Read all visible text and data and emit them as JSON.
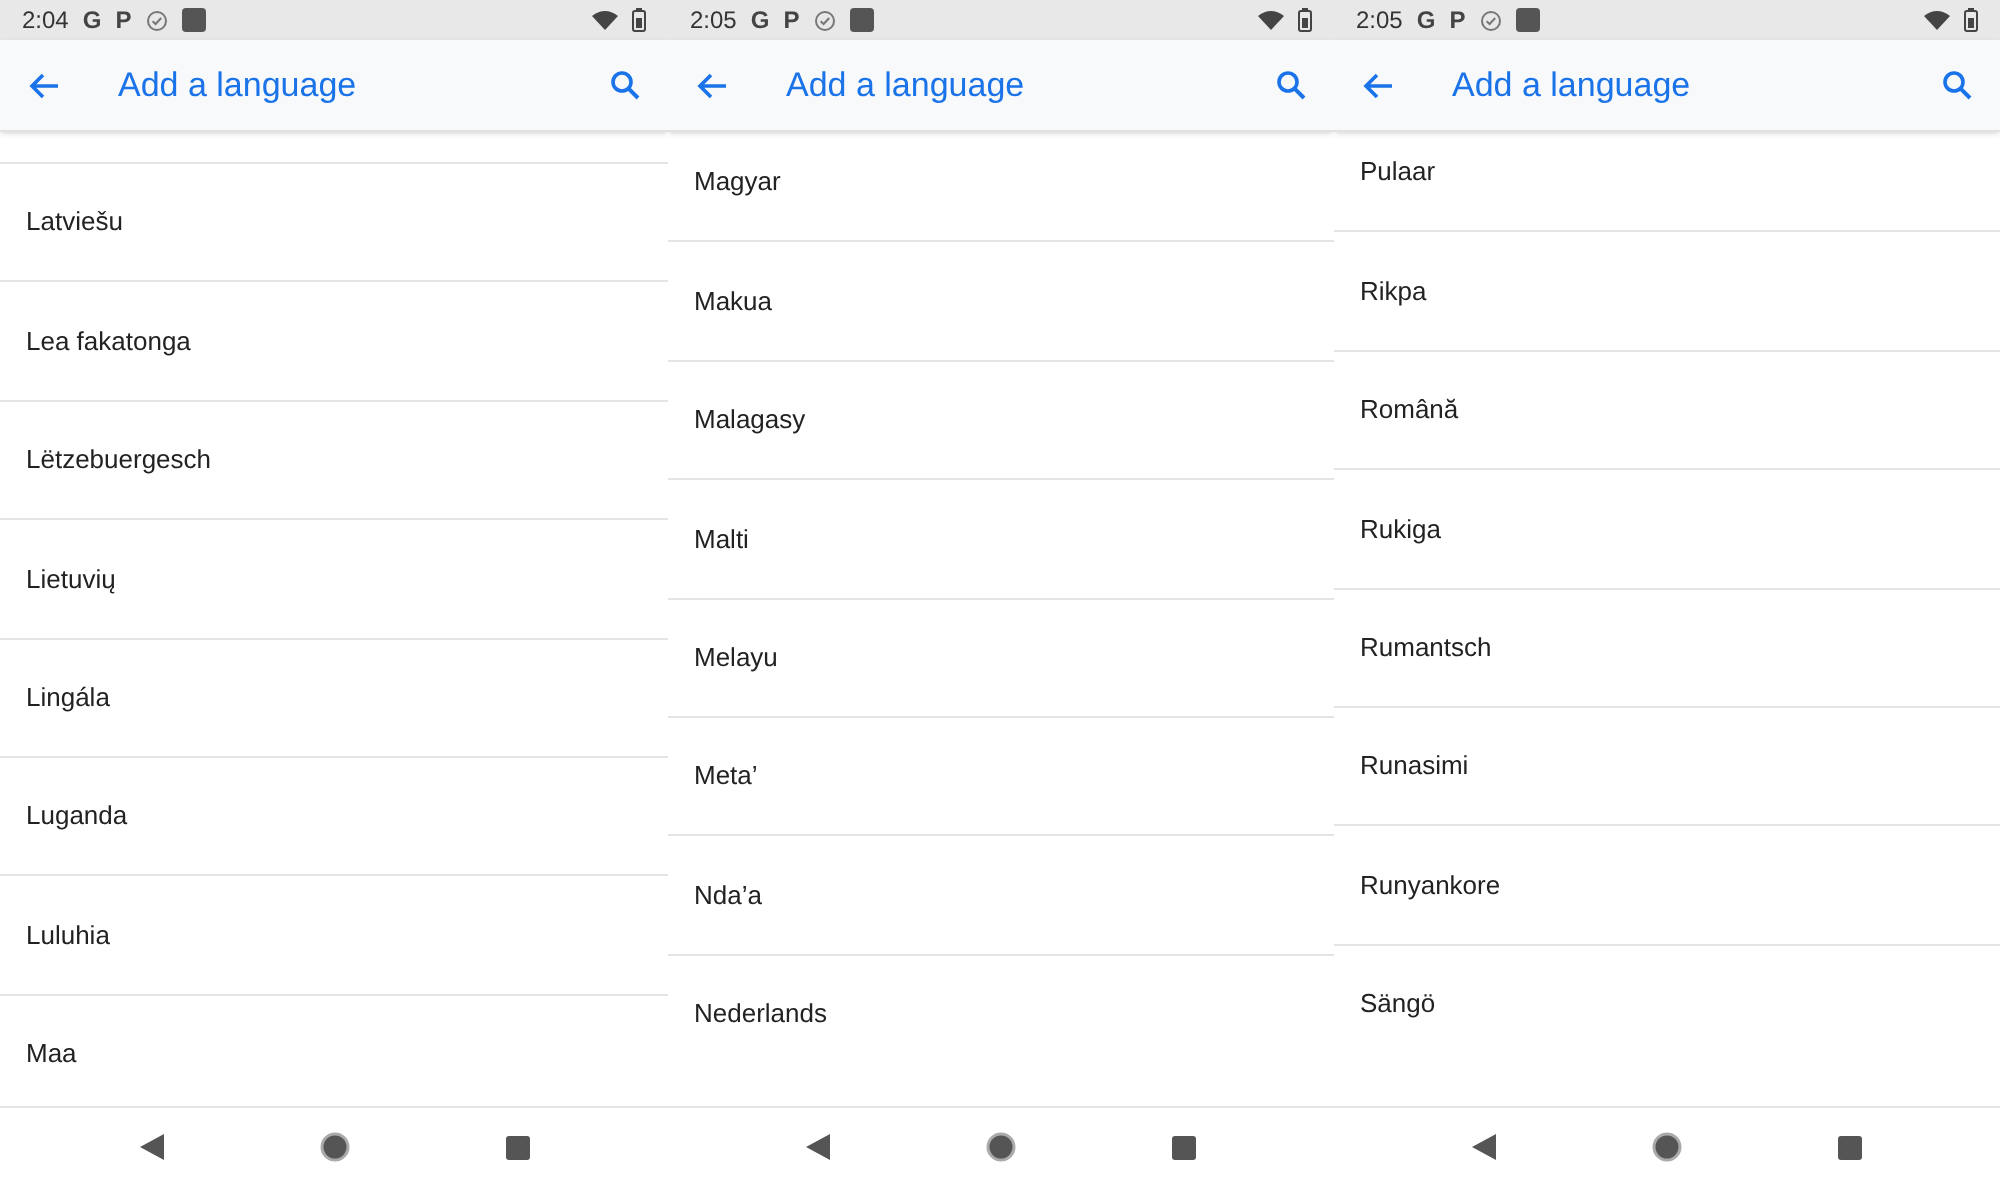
{
  "screens": [
    {
      "status_bar": {
        "time": "2:04",
        "app_letters": [
          "G",
          "P"
        ]
      },
      "app_bar": {
        "title": "Add a language"
      },
      "languages": [
        "Latviešu",
        "Lea fakatonga",
        "Lëtzebuergesch",
        "Lietuvių",
        "Lingála",
        "Luganda",
        "Luluhia",
        "Maa"
      ]
    },
    {
      "status_bar": {
        "time": "2:05",
        "app_letters": [
          "G",
          "P"
        ]
      },
      "app_bar": {
        "title": "Add a language"
      },
      "languages": [
        "Magyar",
        "Makua",
        "Malagasy",
        "Malti",
        "Melayu",
        "Meta’",
        "Nda’a",
        "Nederlands"
      ]
    },
    {
      "status_bar": {
        "time": "2:05",
        "app_letters": [
          "G",
          "P"
        ]
      },
      "app_bar": {
        "title": "Add a language"
      },
      "languages": [
        "Pulaar",
        "Rikpa",
        "Română",
        "Rukiga",
        "Rumantsch",
        "Runasimi",
        "Runyankore",
        "Sängö"
      ]
    }
  ]
}
